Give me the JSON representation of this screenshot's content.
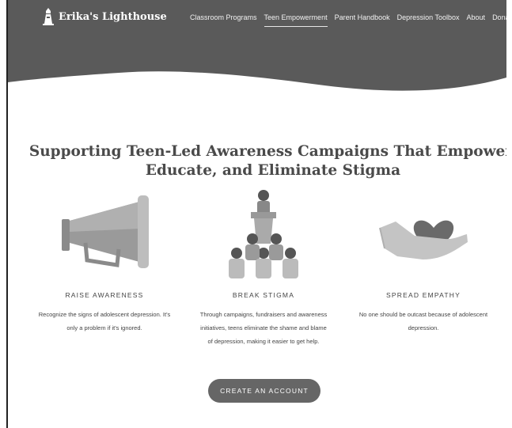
{
  "site": {
    "logo_text": "Erika's Lighthouse"
  },
  "nav": {
    "items": [
      {
        "label": "Classroom Programs"
      },
      {
        "label": "Teen Empowerment"
      },
      {
        "label": "Parent Handbook"
      },
      {
        "label": "Depression Toolbox"
      },
      {
        "label": "About"
      },
      {
        "label": "Donate"
      }
    ],
    "active_index": 1
  },
  "hero": {
    "title_line1": "Supporting Teen-Led Awareness Campaigns That Empower,",
    "title_line2": "Educate, and Eliminate Stigma"
  },
  "features": [
    {
      "icon": "megaphone-icon",
      "title": "RAISE AWARENESS",
      "text_line1": "Recognize the signs of adolescent depression. It's",
      "text_line2": "only a problem if it's ignored.",
      "text_line3": ""
    },
    {
      "icon": "audience-speaker-icon",
      "title": "BREAK STIGMA",
      "text_line1": "Through campaigns, fundraisers and awareness",
      "text_line2": "initiatives, teens eliminate the shame and blame",
      "text_line3": "of depression, making it easier to get help."
    },
    {
      "icon": "hand-heart-icon",
      "title": "SPREAD EMPATHY",
      "text_line1": "No one should be outcast because of adolescent",
      "text_line2": "depression.",
      "text_line3": ""
    }
  ],
  "cta": {
    "label": "CREATE AN ACCOUNT"
  },
  "colors": {
    "header": "#5a5a5a",
    "text": "#444444",
    "button": "#666666"
  }
}
